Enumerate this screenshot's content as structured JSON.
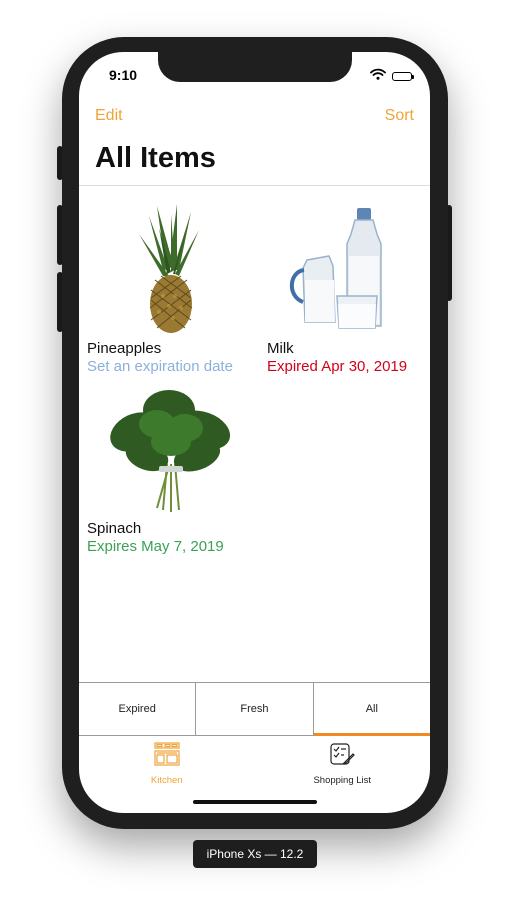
{
  "status_bar": {
    "time": "9:10",
    "wifi_icon": "wifi-icon",
    "battery_icon": "battery-icon"
  },
  "nav": {
    "left_button": "Edit",
    "right_button": "Sort",
    "title": "All Items",
    "accent_color": "#f0a33a"
  },
  "items": [
    {
      "name": "Pineapples",
      "status": "Set an expiration date",
      "status_color": "#8bb1db",
      "image": "pineapple-image"
    },
    {
      "name": "Milk",
      "status": "Expired Apr 30, 2019",
      "status_color": "#d0021b",
      "image": "milk-image"
    },
    {
      "name": "Spinach",
      "status": "Expires May 7, 2019",
      "status_color": "#3aa156",
      "image": "spinach-image"
    }
  ],
  "segments": [
    {
      "label": "Expired",
      "active": false
    },
    {
      "label": "Fresh",
      "active": false
    },
    {
      "label": "All",
      "active": true
    }
  ],
  "tabs": [
    {
      "label": "Kitchen",
      "icon": "kitchen-icon",
      "selected": true,
      "color": "#f0a33a"
    },
    {
      "label": "Shopping List",
      "icon": "shopping-list-icon",
      "selected": false,
      "color": "#222222"
    }
  ],
  "device_label": "iPhone Xs — 12.2"
}
